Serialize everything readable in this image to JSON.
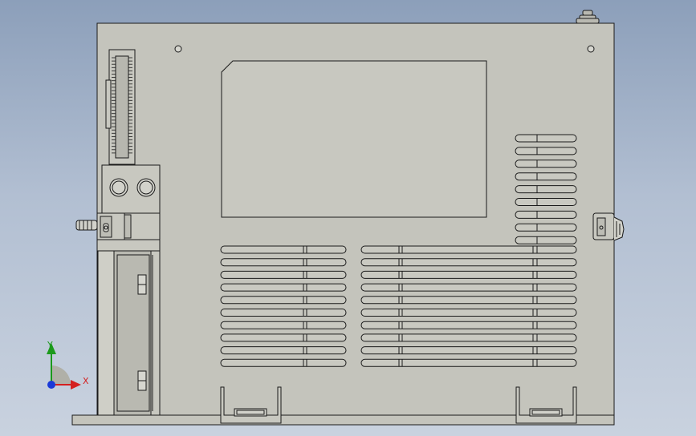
{
  "colors": {
    "background_top": "#8c9fba",
    "background_bottom": "#c9d2df",
    "body_fill": "#c4c4bc",
    "line": "#1a1a1a",
    "axis_x": "#d42020",
    "axis_y": "#1c9a1c",
    "axis_z": "#1a3ad8"
  },
  "triad": {
    "x_label": "X",
    "y_label": "Y"
  }
}
